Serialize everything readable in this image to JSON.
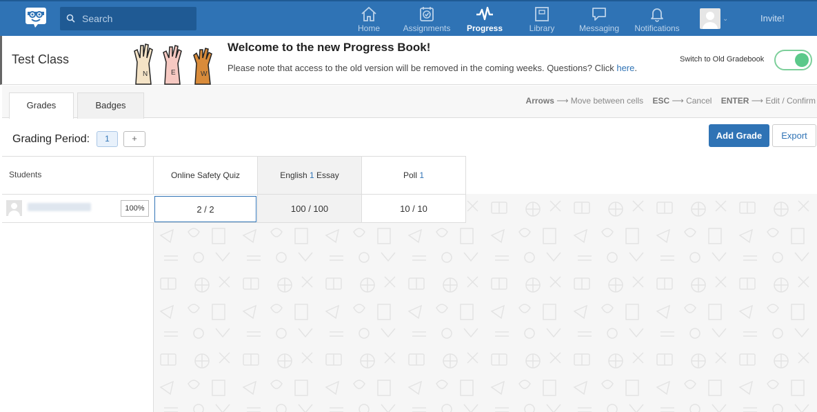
{
  "nav": {
    "search_placeholder": "Search",
    "items": [
      {
        "label": "Home",
        "icon": "home-icon",
        "active": false
      },
      {
        "label": "Assignments",
        "icon": "assignments-icon",
        "active": false
      },
      {
        "label": "Progress",
        "icon": "progress-icon",
        "active": true
      },
      {
        "label": "Library",
        "icon": "library-icon",
        "active": false
      },
      {
        "label": "Messaging",
        "icon": "messaging-icon",
        "active": false
      },
      {
        "label": "Notifications",
        "icon": "notifications-icon",
        "active": false
      }
    ],
    "invite_label": "Invite!"
  },
  "class_header": {
    "class_name": "Test Class",
    "hand_letters": [
      "N",
      "E",
      "W"
    ],
    "welcome_title": "Welcome to the new Progress Book!",
    "welcome_message": "Please note that access to the old version will be removed in the coming weeks. Questions? Click ",
    "welcome_link": "here",
    "welcome_end": ".",
    "switch_label": "Switch to Old Gradebook"
  },
  "tabs": [
    {
      "label": "Grades",
      "active": true
    },
    {
      "label": "Badges",
      "active": false
    }
  ],
  "hints": [
    {
      "key": "Arrows",
      "action": "Move between cells"
    },
    {
      "key": "ESC",
      "action": "Cancel"
    },
    {
      "key": "ENTER",
      "action": "Edit / Confirm"
    }
  ],
  "grading_period": {
    "label": "Grading Period:",
    "current": "1",
    "add_label": "+"
  },
  "actions": {
    "add_grade": "Add Grade",
    "export": "Export"
  },
  "gradebook": {
    "students_header": "Students",
    "columns": [
      {
        "label": "Online Safety Quiz",
        "num": ""
      },
      {
        "label_pre": "English ",
        "num": "1",
        "label_post": " Essay"
      },
      {
        "label_pre": "Poll ",
        "num": "1",
        "label_post": ""
      }
    ],
    "student": {
      "percent": "100%",
      "grades": [
        "2 / 2",
        "100 / 100",
        "10 / 10"
      ]
    }
  },
  "colors": {
    "nav_bg": "#2f73b5",
    "accent": "#2f73b5",
    "toggle_on": "#5bc98a"
  }
}
